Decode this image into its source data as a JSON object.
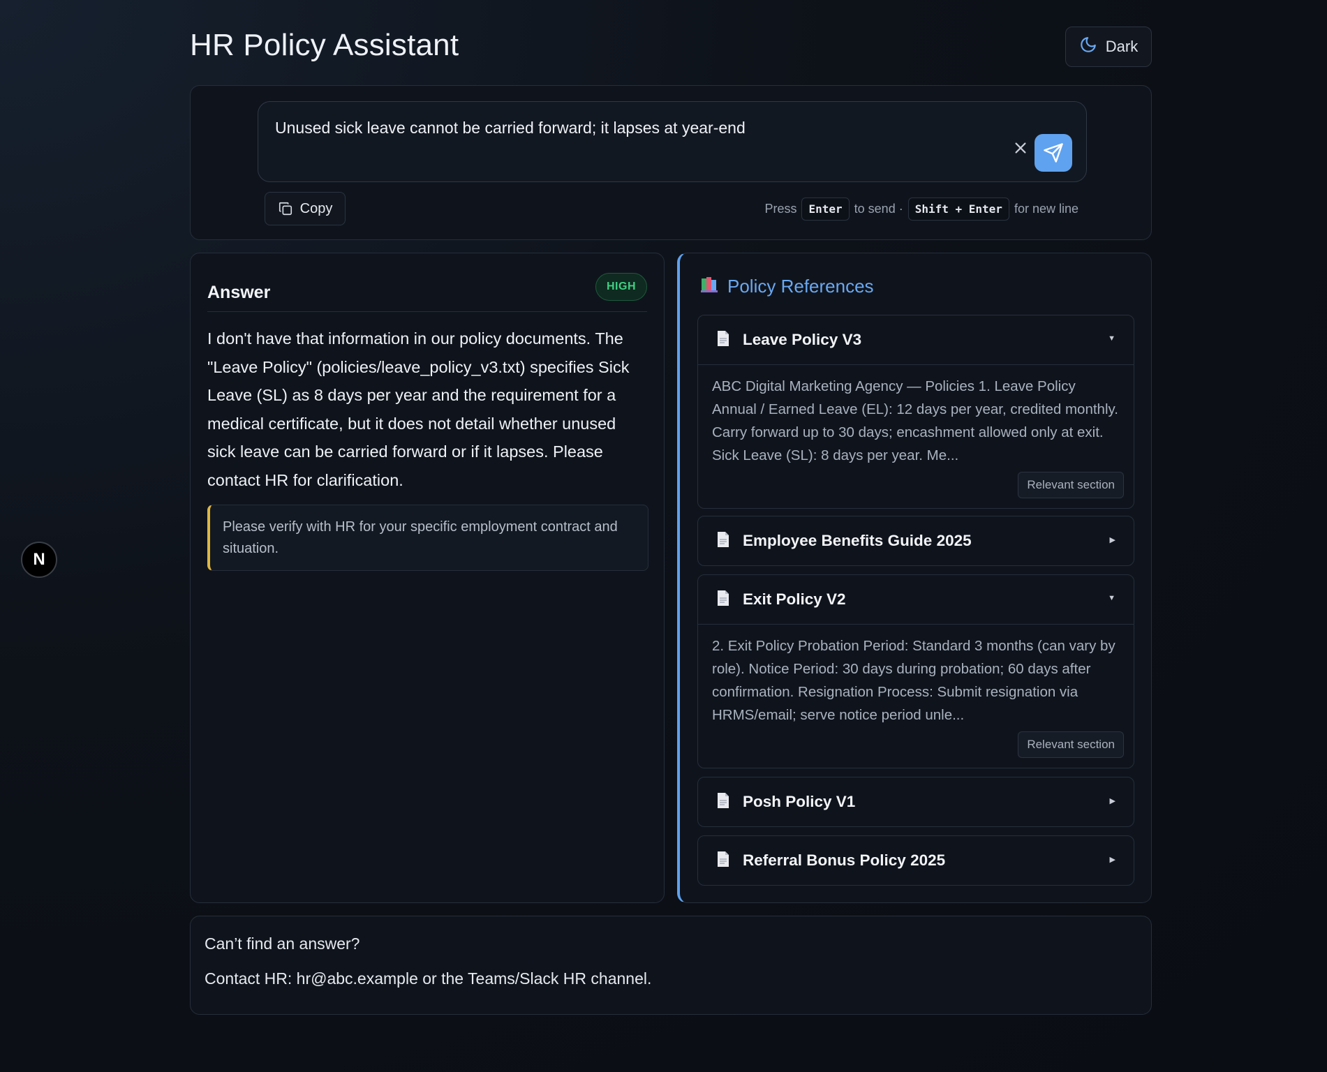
{
  "header": {
    "title": "HR Policy Assistant",
    "theme_label": "Dark"
  },
  "input": {
    "value": "Unused sick leave cannot be carried forward; it lapses at year-end",
    "copy_label": "Copy",
    "hint": {
      "press": "Press",
      "enter": "Enter",
      "to_send": "to send ·",
      "shift_enter": "Shift + Enter",
      "new_line": "for new line"
    }
  },
  "answer": {
    "title": "Answer",
    "confidence": "HIGH",
    "body": "I don't have that information in our policy documents. The \"Leave Policy\" (policies/leave_policy_v3.txt) specifies Sick Leave (SL) as 8 days per year and the requirement for a medical certificate, but it does not detail whether unused sick leave can be carried forward or if it lapses. Please contact HR for clarification.",
    "note": "Please verify with HR for your specific employment contract and situation."
  },
  "references": {
    "title": "Policy References",
    "relevant_label": "Relevant section",
    "items": [
      {
        "name": "Leave Policy V3",
        "expanded": true,
        "excerpt": "ABC Digital Marketing Agency — Policies 1. Leave Policy Annual / Earned Leave (EL): 12 days per year, credited monthly. Carry forward up to 30 days; encashment allowed only at exit. Sick Leave (SL): 8 days per year. Me..."
      },
      {
        "name": "Employee Benefits Guide 2025",
        "expanded": false
      },
      {
        "name": "Exit Policy V2",
        "expanded": true,
        "excerpt": "2. Exit Policy Probation Period: Standard 3 months (can vary by role). Notice Period: 30 days during probation; 60 days after confirmation. Resignation Process: Submit resignation via HRMS/email; serve notice period unle..."
      },
      {
        "name": "Posh Policy V1",
        "expanded": false
      },
      {
        "name": "Referral Bonus Policy 2025",
        "expanded": false
      }
    ]
  },
  "footer": {
    "question": "Can’t find an answer?",
    "contact": "Contact HR: hr@abc.example or the Teams/Slack HR channel."
  },
  "dev_badge": {
    "letter": "N"
  },
  "colors": {
    "accent": "#5fa2ef",
    "badge_high": "#3fcf82",
    "note_border": "#e0b743"
  }
}
